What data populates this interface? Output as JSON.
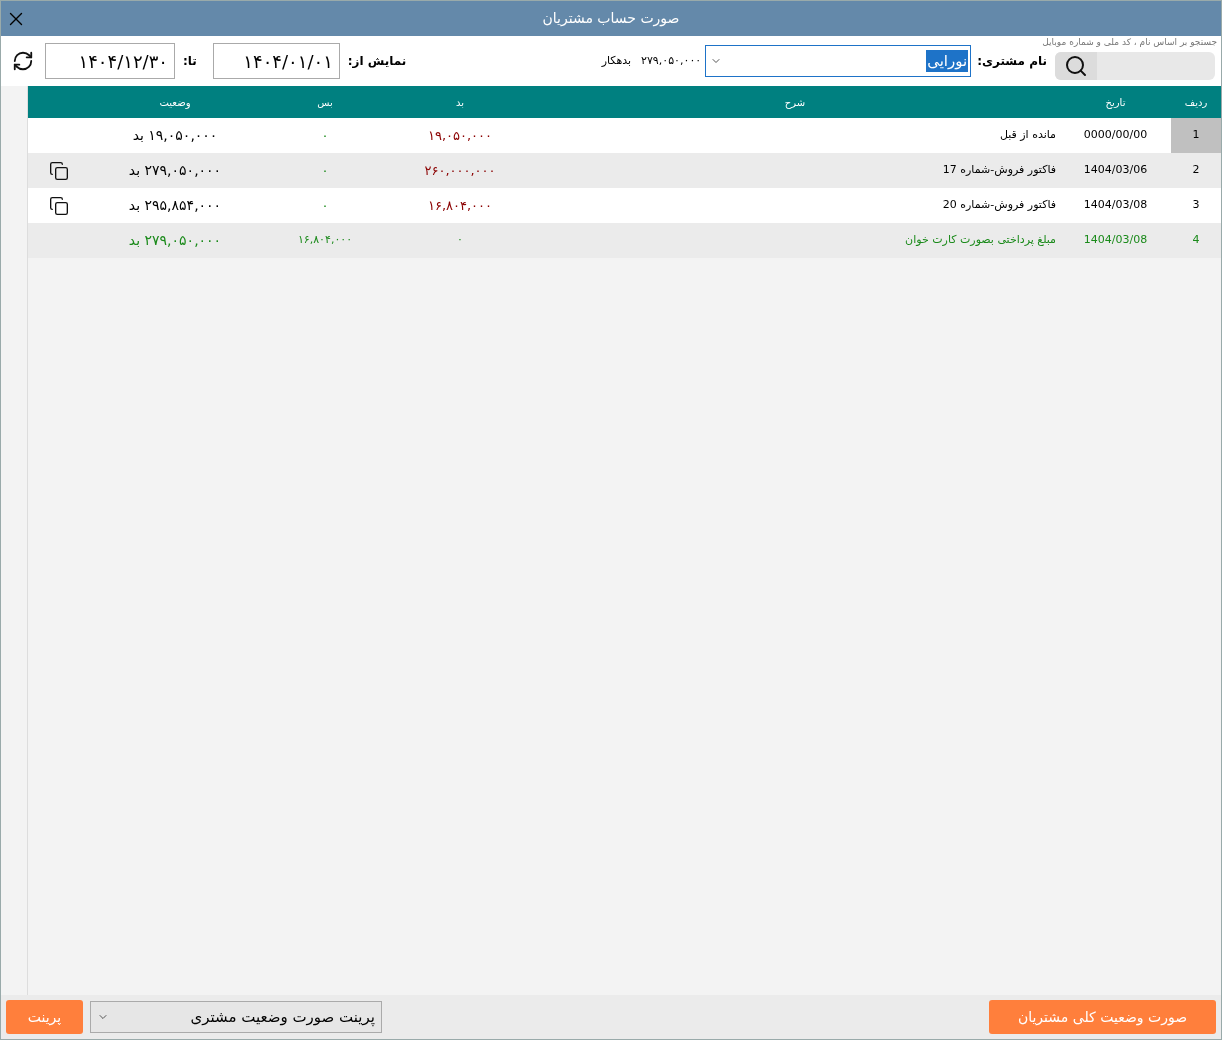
{
  "window": {
    "title": "صورت حساب مشتریان"
  },
  "search": {
    "hint": "جستجو بر اساس نام ، کد ملی و شماره موبایل",
    "customer_label": "نام مشتری:",
    "customer_value": "نورایی",
    "balance": "۲۷۹,۰۵۰,۰۰۰",
    "balance_status": "بدهکار"
  },
  "date_range": {
    "from_label": "نمایش از:",
    "from": "۱۴۰۴/۰۱/۰۱",
    "to_label": "تا:",
    "to": "۱۴۰۴/۱۲/۳۰"
  },
  "table": {
    "columns": [
      "ردیف",
      "تاریخ",
      "شرح",
      "بد",
      "بس",
      "وضعیت"
    ],
    "rows": [
      {
        "kind": "balance",
        "selected": true,
        "attachment": false,
        "cells": [
          "1",
          "0000/00/00",
          "مانده از قبل",
          "۱۹,۰۵۰,۰۰۰",
          "۰",
          "۱۹,۰۵۰,۰۰۰ بد"
        ]
      },
      {
        "kind": "invoice",
        "selected": false,
        "attachment": true,
        "cells": [
          "2",
          "1404/03/06",
          "فاکتور فروش-شماره 17",
          "۲۶۰,۰۰۰,۰۰۰",
          "۰",
          "۲۷۹,۰۵۰,۰۰۰ بد"
        ]
      },
      {
        "kind": "invoice",
        "selected": false,
        "attachment": true,
        "cells": [
          "3",
          "1404/03/08",
          "فاکتور فروش-شماره 20",
          "۱۶,۸۰۴,۰۰۰",
          "۰",
          "۲۹۵,۸۵۴,۰۰۰ بد"
        ]
      },
      {
        "kind": "payment",
        "selected": false,
        "attachment": false,
        "cells": [
          "4",
          "1404/03/08",
          "مبلغ پرداختی بصورت کارت خوان",
          "۰",
          "۱۶,۸۰۴,۰۰۰",
          "۲۷۹,۰۵۰,۰۰۰ بد"
        ]
      }
    ]
  },
  "footer": {
    "summary_button": "صورت وضعیت کلی مشتریان",
    "report_select": "پرینت صورت وضعیت مشتری",
    "print_button": "پرینت"
  }
}
